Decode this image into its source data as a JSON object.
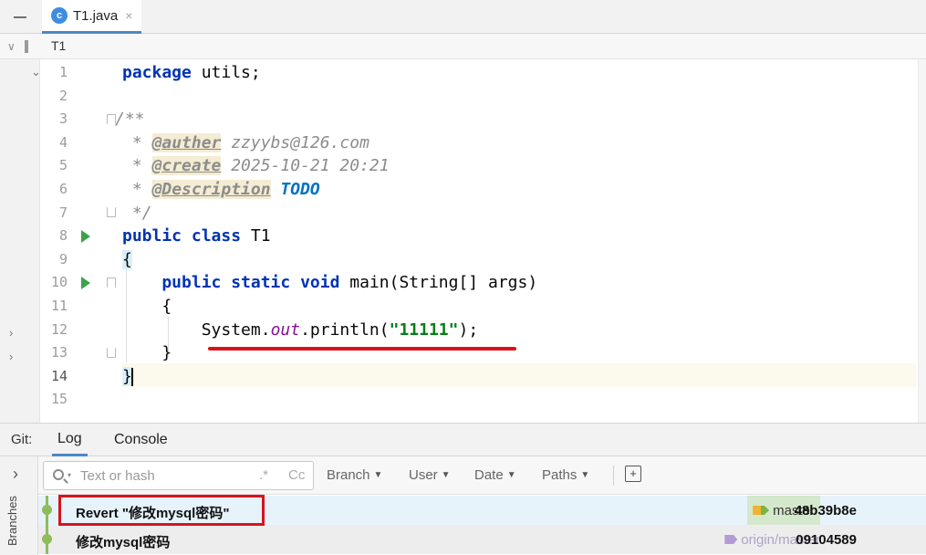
{
  "tab": {
    "filename": "T1.java",
    "icon": "class-icon",
    "icon_glyph": "c"
  },
  "breadcrumb": {
    "item": "T1"
  },
  "editor": {
    "line_numbers": [
      "1",
      "2",
      "3",
      "4",
      "5",
      "6",
      "7",
      "8",
      "9",
      "10",
      "11",
      "12",
      "13",
      "14",
      "15"
    ],
    "current_line": 14,
    "code": {
      "l1_kw": "package",
      "l1_rest": " utils;",
      "l3": "/**",
      "l4_star": " * ",
      "l4_tag": "@auther",
      "l4_rest": " zzyybs@126.com",
      "l5_star": " * ",
      "l5_tag": "@create",
      "l5_rest": " 2025-10-21 20:21",
      "l6_star": " * ",
      "l6_tag": "@Description",
      "l6_todo": "TODO",
      "l7": " */",
      "l8_kw": "public class",
      "l8_rest": " T1",
      "l9": "{",
      "l10_kw": "    public static void",
      "l10_rest": " main(String[] args)",
      "l11": "    {",
      "l12_a": "        System.",
      "l12_field": "out",
      "l12_b": ".println(",
      "l12_str": "\"11111\"",
      "l12_c": ");",
      "l13": "    }",
      "l14": "}"
    }
  },
  "git": {
    "title": "Git:",
    "tabs": [
      "Log",
      "Console"
    ],
    "active_tab": "Log",
    "side_label": "Branches",
    "search": {
      "placeholder": "Text or hash",
      "regex_glyph": ".*",
      "case_glyph": "Cc"
    },
    "filters": [
      "Branch",
      "User",
      "Date",
      "Paths"
    ],
    "commits": [
      {
        "message": "Revert \"修改mysql密码\"",
        "branch": "master",
        "hash": "48b39b8e",
        "selected": true
      },
      {
        "message": "修改mysql密码",
        "branch": "origin/master",
        "hash": "09104589",
        "selected": false
      }
    ]
  },
  "colors": {
    "accent": "#4a88c7",
    "annotation_red": "#d8141b",
    "keyword": "#0033b3",
    "string": "#067d17"
  }
}
